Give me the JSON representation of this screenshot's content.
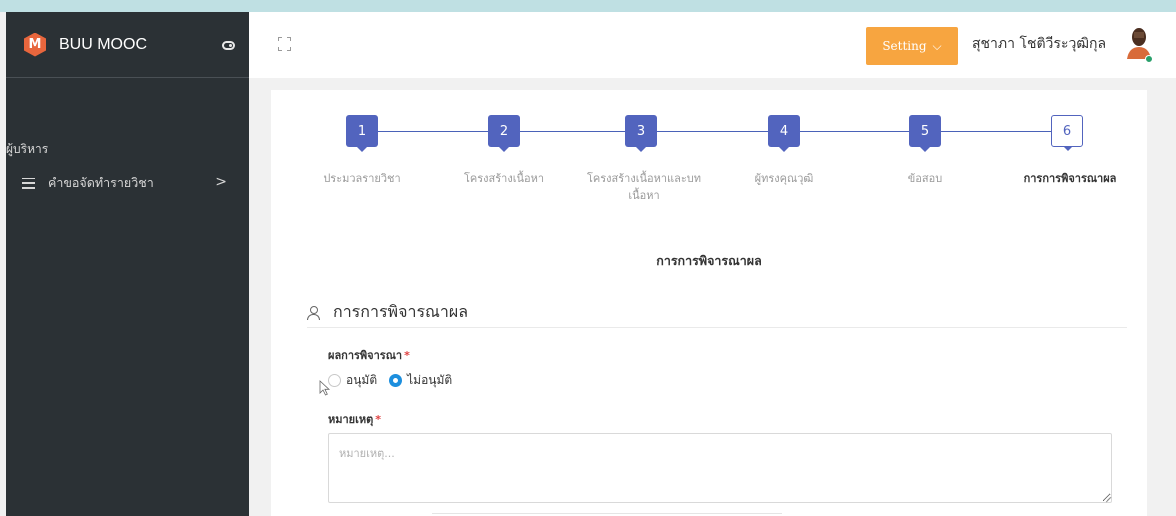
{
  "brand": {
    "name": "BUU MOOC",
    "logo_letter": "M",
    "logo_color": "#e8663d"
  },
  "sidebar": {
    "section_label": "ผู้บริหาร",
    "items": [
      {
        "label": "คำขอจัดทำรายวิชา",
        "icon": "menu-icon",
        "chevron": ">"
      }
    ]
  },
  "header": {
    "setting_label": "Setting",
    "setting_caret": "⌵",
    "user_name": "สุชาภา โชติวีระวุฒิกุล",
    "accent_color": "#f7a540"
  },
  "stepper": {
    "steps": [
      {
        "number": "1",
        "label": "ประมวลรายวิชา"
      },
      {
        "number": "2",
        "label": "โครงสร้างเนื้อหา"
      },
      {
        "number": "3",
        "label": "โครงสร้างเนื้อหาและบทเนื้อหา"
      },
      {
        "number": "4",
        "label": "ผู้ทรงคุณวุฒิ"
      },
      {
        "number": "5",
        "label": "ข้อสอบ"
      },
      {
        "number": "6",
        "label": "การการพิจารณาผล"
      }
    ],
    "active_step": 6,
    "color": "#5264be"
  },
  "main": {
    "center_title": "การการพิจารณาผล",
    "section_title": "การการพิจารณาผล",
    "result_label": "ผลการพิจารณา",
    "required_mark": "*",
    "options": [
      {
        "label": "อนุมัติ",
        "checked": false
      },
      {
        "label": "ไม่อนุมัติ",
        "checked": true
      }
    ],
    "note_label": "หมายเหตุ",
    "note_placeholder": "หมายเหตุ..."
  }
}
